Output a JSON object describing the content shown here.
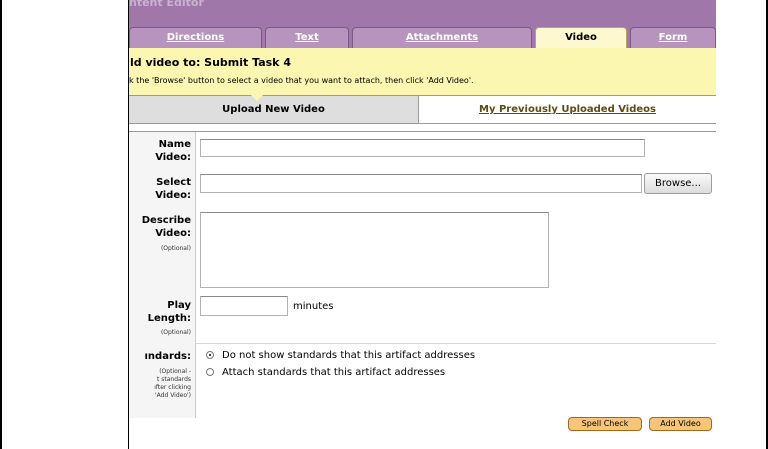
{
  "window": {
    "title": "ntent Editor"
  },
  "tabs": [
    {
      "label": "Directions",
      "active": false
    },
    {
      "label": "Text",
      "active": false
    },
    {
      "label": "Attachments",
      "active": false
    },
    {
      "label": "Video",
      "active": true
    },
    {
      "label": "Form",
      "active": false
    }
  ],
  "notice": {
    "title": "ld video to: Submit Task 4",
    "text": "k the 'Browse' button to select a video that you want to attach, then click 'Add Video'."
  },
  "subtabs": {
    "upload": "Upload New Video",
    "previous": "My Previously Uploaded Videos"
  },
  "form": {
    "name": {
      "label_line1": "Name",
      "label_line2": "Video:",
      "value": ""
    },
    "select": {
      "label_line1": "Select",
      "label_line2": "Video:",
      "value": "",
      "browse_label": "Browse..."
    },
    "describe": {
      "label_line1": "Describe",
      "label_line2": "Video:",
      "optional": "(Optional)",
      "value": ""
    },
    "play_length": {
      "label_line1": "Play",
      "label_line2": "Length:",
      "optional": "(Optional)",
      "value": "",
      "unit": "minutes"
    },
    "standards": {
      "label": "ındards:",
      "note_line1": "(Optional -",
      "note_line2": "t standards",
      "note_line3": "ıfter clicking",
      "note_line4": "'Add Video')",
      "option1": "Do not show standards that this artifact addresses",
      "option2": "Attach standards that this artifact addresses",
      "selected": "option1"
    }
  },
  "actions": {
    "spell_check": "Spell Check",
    "add_video": "Add Video"
  },
  "colors": {
    "titlebar": "#9f77a8",
    "notice_bg": "#fbf6b0",
    "button_orange": "#f6c57a"
  }
}
